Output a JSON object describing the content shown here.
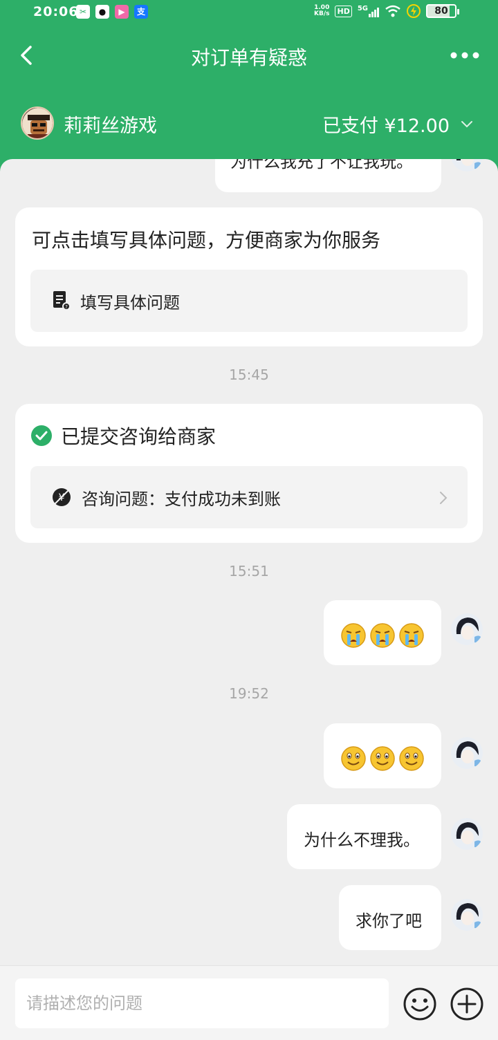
{
  "status_bar": {
    "time": "20:06",
    "apps": [
      {
        "name": "scissors-app-icon",
        "glyph": "✂",
        "color": "#2daf68"
      },
      {
        "name": "qq-app-icon",
        "glyph": "●",
        "color": "#111111"
      },
      {
        "name": "video-app-icon",
        "glyph": "▶",
        "color": "#f06aa8"
      },
      {
        "name": "alipay-app-icon",
        "glyph": "支",
        "color": "#1677ff"
      }
    ],
    "network_speed": "1.00\nKB/s",
    "hd_label": "HD",
    "signal_label": "5G",
    "battery": "80"
  },
  "header": {
    "title": "对订单有疑惑",
    "shop_name": "莉莉丝游戏",
    "pay_status": "已支付 ¥12.00",
    "bg_color": "#2daf68"
  },
  "messages": {
    "partial_text": "为什么我充了不让我玩。",
    "prompt_card": {
      "title": "可点击填写具体问题，方便商家为你服务",
      "action_label": "填写具体问题"
    },
    "time_1": "15:45",
    "submitted_card": {
      "title": "已提交咨询给商家",
      "issue_label": "咨询问题：支付成功未到账"
    },
    "time_2": "15:51",
    "time_3": "19:52",
    "msg_why": "为什么不理我。",
    "msg_beg": "求你了吧"
  },
  "input_bar": {
    "placeholder": "请描述您的问题"
  }
}
